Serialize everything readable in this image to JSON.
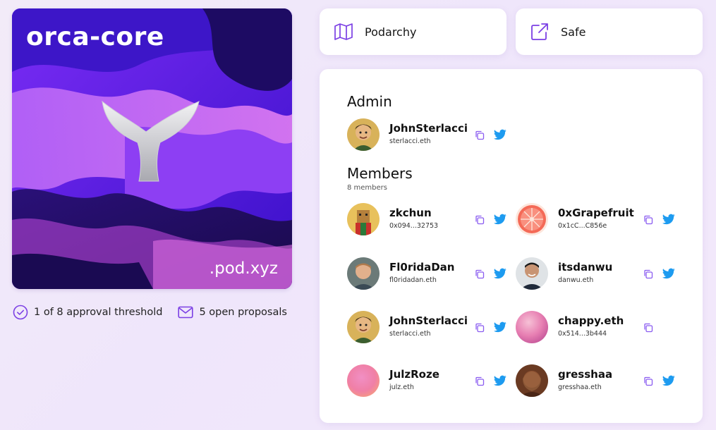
{
  "pod": {
    "name": "orca-core",
    "domain": ".pod.xyz",
    "approval_threshold": "1 of 8 approval threshold",
    "open_proposals": "5 open proposals"
  },
  "links": [
    {
      "label": "Podarchy",
      "icon": "map-icon"
    },
    {
      "label": "Safe",
      "icon": "external-link-icon"
    }
  ],
  "admin": {
    "title": "Admin",
    "member": {
      "name": "JohnSterlacci",
      "address": "sterlacci.eth",
      "twitter": true
    }
  },
  "members": {
    "title": "Members",
    "count_label": "8 members",
    "list": [
      {
        "name": "zkchun",
        "address": "0x094...32753",
        "twitter": true
      },
      {
        "name": "0xGrapefruit",
        "address": "0x1cC...C856e",
        "twitter": true
      },
      {
        "name": "Fl0ridaDan",
        "address": "fl0ridadan.eth",
        "twitter": true
      },
      {
        "name": "itsdanwu",
        "address": "danwu.eth",
        "twitter": true
      },
      {
        "name": "JohnSterlacci",
        "address": "sterlacci.eth",
        "twitter": true
      },
      {
        "name": "chappy.eth",
        "address": "0x514...3b444",
        "twitter": false
      },
      {
        "name": "JulzRoze",
        "address": "julz.eth",
        "twitter": true
      },
      {
        "name": "gresshaa",
        "address": "gresshaa.eth",
        "twitter": true
      }
    ]
  },
  "colors": {
    "accent": "#7b3fe4",
    "twitter": "#1d9bf0",
    "copy_icon": "#8a5cf0"
  }
}
